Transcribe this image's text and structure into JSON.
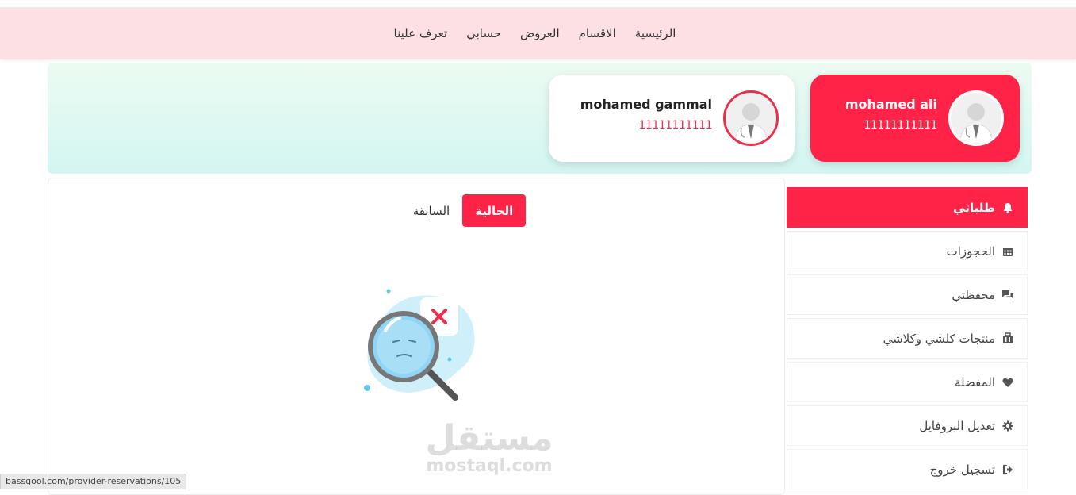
{
  "nav": {
    "items": [
      "الرئيسية",
      "الاقسام",
      "العروض",
      "حسابي",
      "تعرف علينا"
    ]
  },
  "profiles": [
    {
      "name": "mohamed ali",
      "phone": "11111111111",
      "active": true
    },
    {
      "name": "mohamed gammal",
      "phone": "11111111111",
      "active": false
    }
  ],
  "tabs": {
    "current": "الحالية",
    "previous": "السابقة"
  },
  "sidebar": {
    "items": [
      {
        "label": "طلباتي",
        "icon": "bell-icon"
      },
      {
        "label": "الحجوزات",
        "icon": "calendar-icon"
      },
      {
        "label": "محفظتي",
        "icon": "chat-icon"
      },
      {
        "label": "منتجات كلشي وكلاشي",
        "icon": "luggage-icon"
      },
      {
        "label": "المفضلة",
        "icon": "heart-icon"
      },
      {
        "label": "تعديل البروفايل",
        "icon": "gear-icon"
      },
      {
        "label": "تسجيل خروج",
        "icon": "sign-out-icon"
      }
    ]
  },
  "watermark": {
    "arabic": "مستقل",
    "latin": "mostaql.com"
  },
  "status_bar": {
    "url": "bassgool.com/provider-reservations/105"
  },
  "colors": {
    "accent": "#ff2447",
    "nav_bg": "#fde0e4",
    "banner_top": "#ecfbf1",
    "banner_bottom": "#d3f6f3"
  }
}
